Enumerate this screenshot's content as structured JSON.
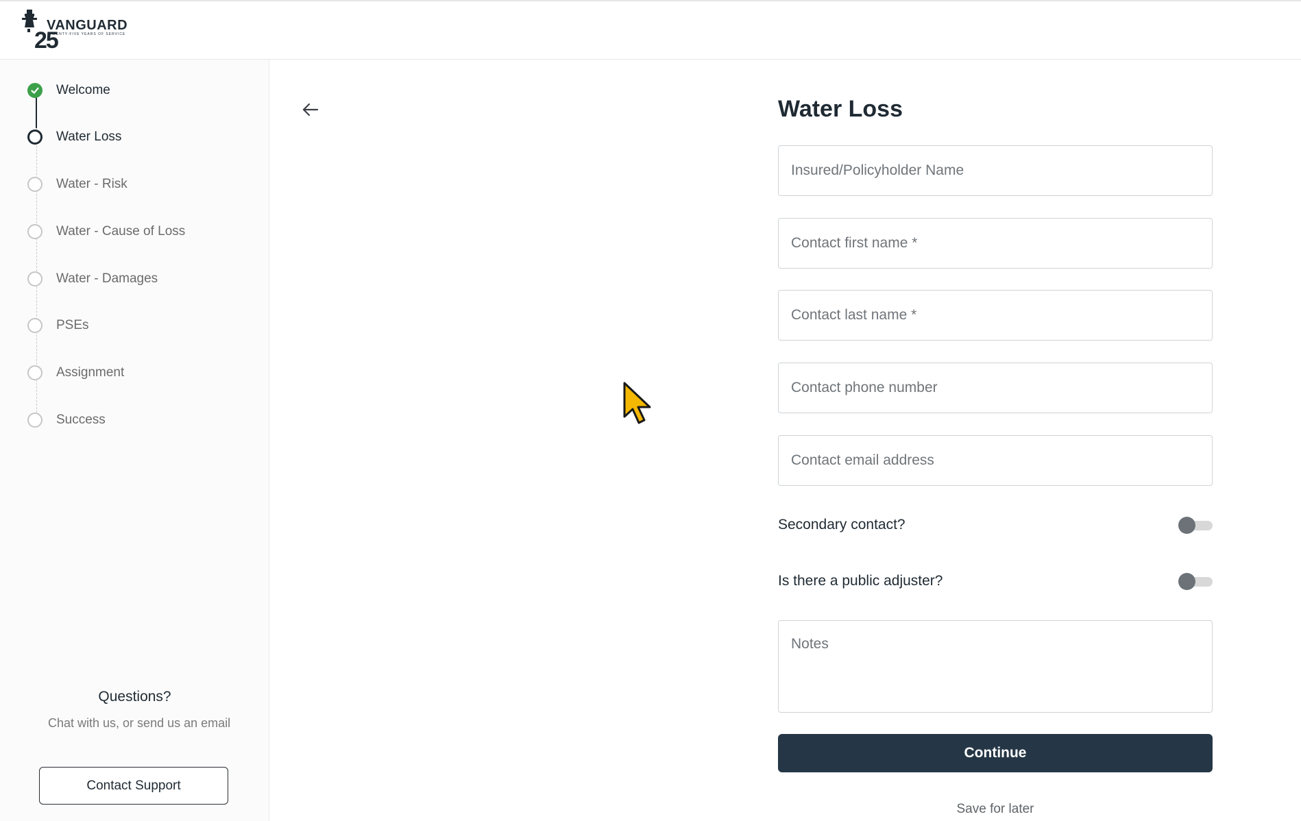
{
  "brand": {
    "name": "VANGUARD",
    "tagline": "TWENTY-FIVE YEARS OF SERVICE",
    "anniversary": "25"
  },
  "sidebar": {
    "steps": [
      {
        "label": "Welcome",
        "state": "done"
      },
      {
        "label": "Water Loss",
        "state": "current"
      },
      {
        "label": "Water - Risk",
        "state": "pending"
      },
      {
        "label": "Water - Cause of Loss",
        "state": "pending"
      },
      {
        "label": "Water - Damages",
        "state": "pending"
      },
      {
        "label": "PSEs",
        "state": "pending"
      },
      {
        "label": "Assignment",
        "state": "pending"
      },
      {
        "label": "Success",
        "state": "pending"
      }
    ],
    "questions_title": "Questions?",
    "questions_text": "Chat with us, or send us an email",
    "contact_button": "Contact Support"
  },
  "form": {
    "title": "Water Loss",
    "fields": {
      "insured_name": {
        "placeholder": "Insured/Policyholder Name",
        "value": ""
      },
      "first_name": {
        "placeholder": "Contact first name *",
        "value": ""
      },
      "last_name": {
        "placeholder": "Contact last name *",
        "value": ""
      },
      "phone": {
        "placeholder": "Contact phone number",
        "value": ""
      },
      "email": {
        "placeholder": "Contact email address",
        "value": ""
      },
      "notes": {
        "placeholder": "Notes",
        "value": ""
      }
    },
    "toggles": {
      "secondary_contact": {
        "label": "Secondary contact?",
        "on": false
      },
      "public_adjuster": {
        "label": "Is there a public adjuster?",
        "on": false
      }
    },
    "continue_label": "Continue",
    "save_later_label": "Save for later"
  },
  "colors": {
    "primary": "#253746",
    "done": "#3ca04a",
    "cursor": "#f5b800"
  }
}
